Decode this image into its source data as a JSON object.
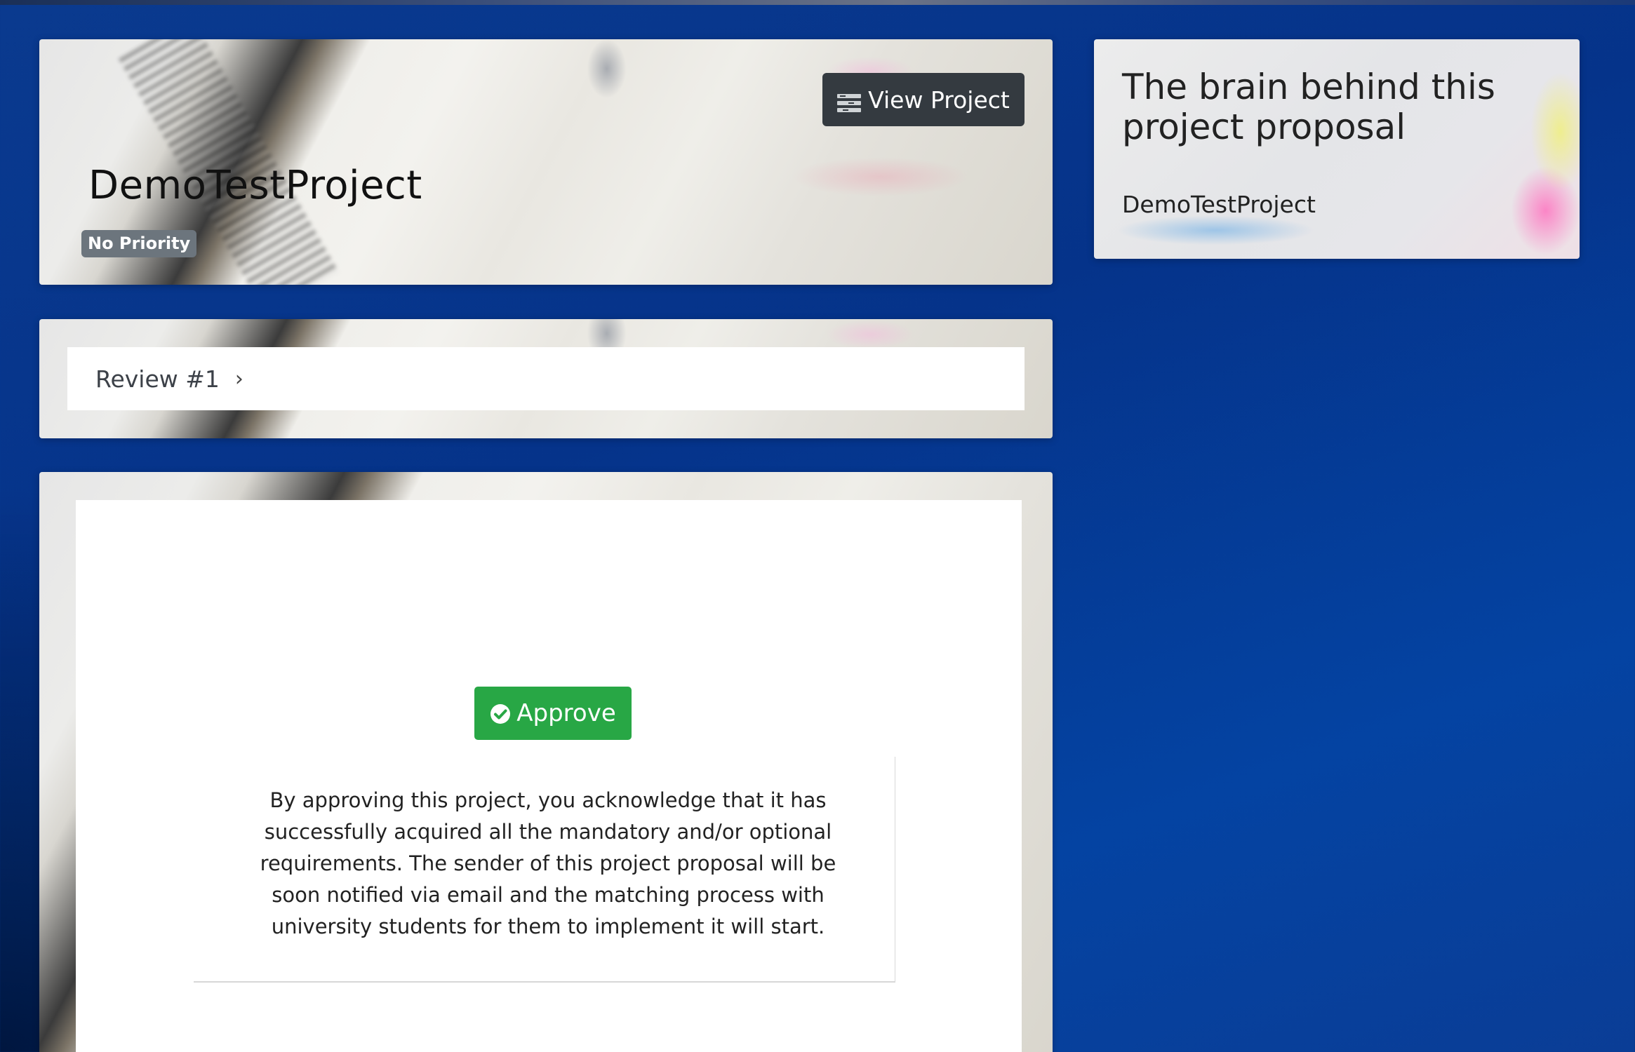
{
  "project": {
    "title": "DemoTestProject",
    "priority_badge": "No Priority",
    "view_button_label": "View Project"
  },
  "review": {
    "label": "Review #1"
  },
  "approval": {
    "button_label": "Approve",
    "acknowledgement": "By approving this project, you acknowledge that it has successfully acquired all the mandatory and/or optional requirements. The sender of this project proposal will be soon notified via email and the matching process with university students for them to implement it will start."
  },
  "sidebar": {
    "heading": "The brain behind this project proposal",
    "project_name": "DemoTestProject"
  },
  "colors": {
    "background": "#05338a",
    "approve": "#28a745",
    "dark_button": "#343a40",
    "badge": "#6c757d"
  },
  "icons": {
    "view": "list-icon",
    "approve": "check-circle-icon",
    "review": "chevron-right-icon"
  }
}
